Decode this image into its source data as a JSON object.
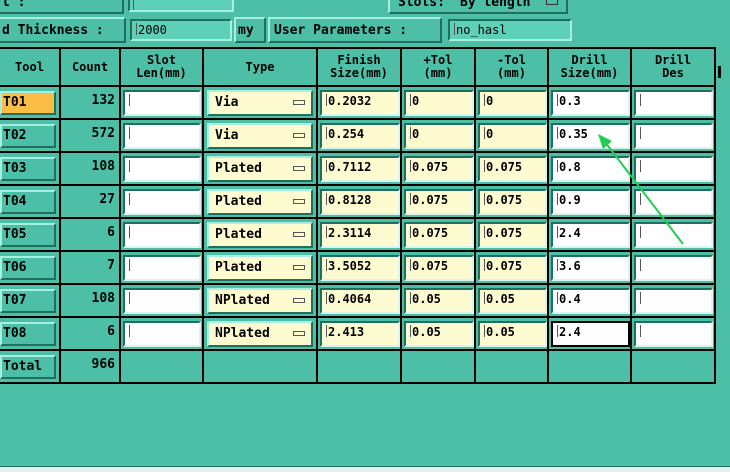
{
  "top": {
    "row0_left_label": "l        :",
    "slots_label": "Slots:",
    "slots_value": "By length",
    "board_thickness_label": "d Thickness :",
    "board_thickness_value": "2000",
    "board_thickness_unit": "my",
    "user_params_label": "User Parameters :",
    "user_params_value": "no_hasl"
  },
  "columns": [
    {
      "key": "tool",
      "label": "Tool"
    },
    {
      "key": "count",
      "label": "Count"
    },
    {
      "key": "slot",
      "label": "Slot\nLen(mm)"
    },
    {
      "key": "type",
      "label": "Type"
    },
    {
      "key": "finish",
      "label": "Finish\nSize(mm)"
    },
    {
      "key": "ptol",
      "label": "+Tol\n(mm)"
    },
    {
      "key": "mtol",
      "label": "-Tol\n(mm)"
    },
    {
      "key": "drill",
      "label": "Drill\nSize(mm)"
    },
    {
      "key": "drill_des",
      "label": "Drill\nDes"
    }
  ],
  "rows": [
    {
      "tool": "T01",
      "count": "132",
      "slot": "",
      "type": "Via",
      "finish": "0.2032",
      "ptol": "0",
      "mtol": "0",
      "drill": "0.3",
      "drill_des": "",
      "active": true
    },
    {
      "tool": "T02",
      "count": "572",
      "slot": "",
      "type": "Via",
      "finish": "0.254",
      "ptol": "0",
      "mtol": "0",
      "drill": "0.35",
      "drill_des": ""
    },
    {
      "tool": "T03",
      "count": "108",
      "slot": "",
      "type": "Plated",
      "finish": "0.7112",
      "ptol": "0.075",
      "mtol": "0.075",
      "drill": "0.8",
      "drill_des": ""
    },
    {
      "tool": "T04",
      "count": "27",
      "slot": "",
      "type": "Plated",
      "finish": "0.8128",
      "ptol": "0.075",
      "mtol": "0.075",
      "drill": "0.9",
      "drill_des": ""
    },
    {
      "tool": "T05",
      "count": "6",
      "slot": "",
      "type": "Plated",
      "finish": "2.3114",
      "ptol": "0.075",
      "mtol": "0.075",
      "drill": "2.4",
      "drill_des": ""
    },
    {
      "tool": "T06",
      "count": "7",
      "slot": "",
      "type": "Plated",
      "finish": "3.5052",
      "ptol": "0.075",
      "mtol": "0.075",
      "drill": "3.6",
      "drill_des": ""
    },
    {
      "tool": "T07",
      "count": "108",
      "slot": "",
      "type": "NPlated",
      "finish": "0.4064",
      "ptol": "0.05",
      "mtol": "0.05",
      "drill": "0.4",
      "drill_des": ""
    },
    {
      "tool": "T08",
      "count": "6",
      "slot": "",
      "type": "NPlated",
      "finish": "2.413",
      "ptol": "0.05",
      "mtol": "0.05",
      "drill": "2.4",
      "drill_des": "",
      "focus_drill": true
    }
  ],
  "total": {
    "label": "Total",
    "count": "966"
  },
  "colors": {
    "bg": "#4cbfa6",
    "active_tool": "#fbbd45",
    "field": "#fffbd0",
    "arrow": "#22cc55"
  }
}
